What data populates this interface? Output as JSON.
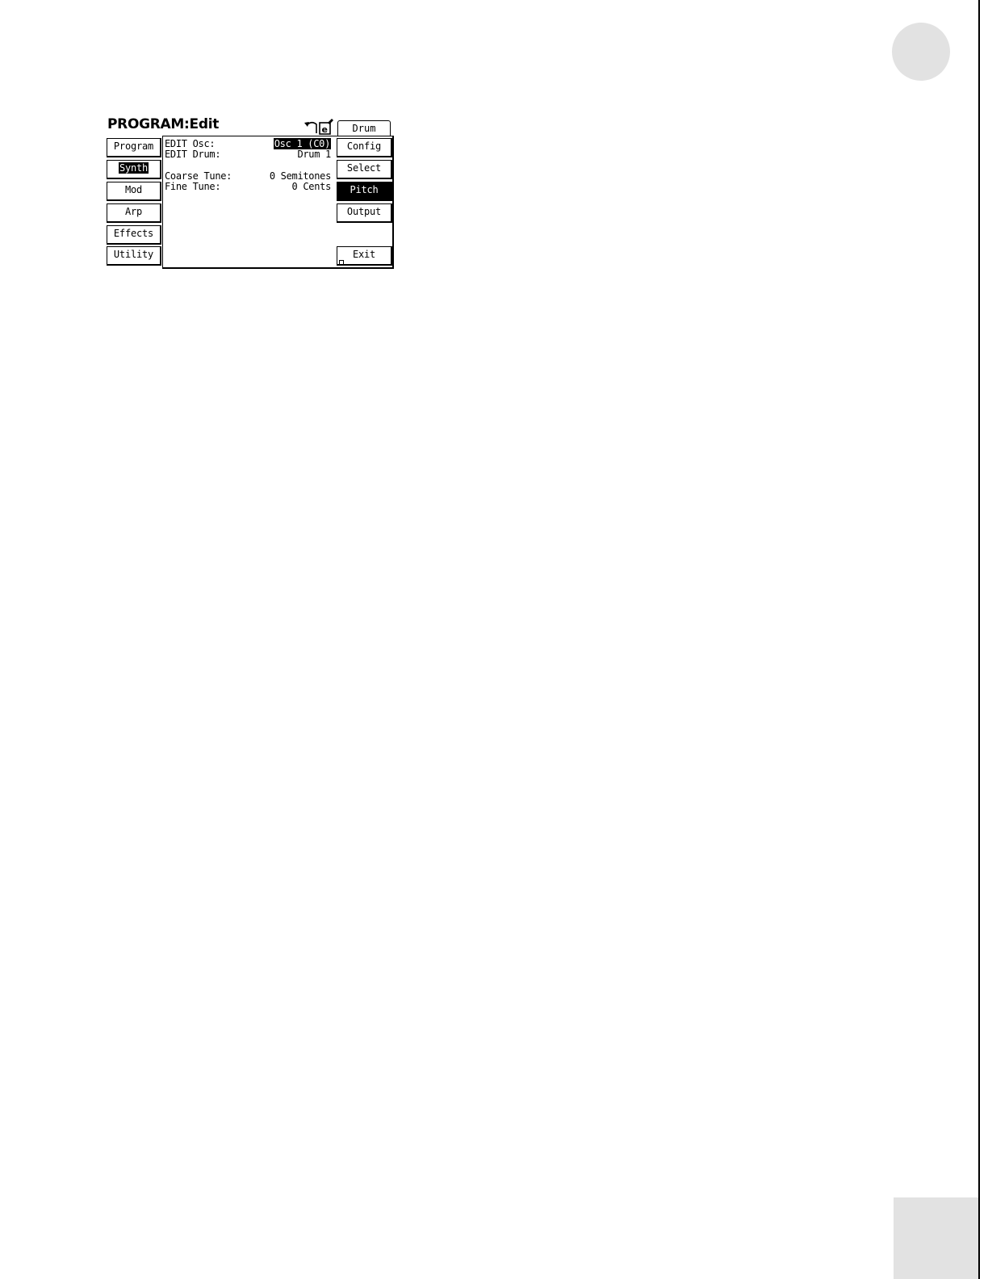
{
  "screen": {
    "title": "PROGRAM:Edit",
    "icons": [
      "undo-arrow-icon",
      "edit-document-icon"
    ]
  },
  "left_tabs": [
    {
      "label": "Program",
      "active": false,
      "selected": false
    },
    {
      "label": "Synth",
      "active": false,
      "selected": true
    },
    {
      "label": "Mod",
      "active": false,
      "selected": false
    },
    {
      "label": "Arp",
      "active": false,
      "selected": false
    },
    {
      "label": "Effects",
      "active": false,
      "selected": false
    },
    {
      "label": "Utility",
      "active": false,
      "selected": false
    }
  ],
  "top_right_tab": {
    "label": "Drum"
  },
  "right_buttons": [
    {
      "label": "Config",
      "active": false
    },
    {
      "label": "Select",
      "active": false
    },
    {
      "label": "Pitch",
      "active": true
    },
    {
      "label": "Output",
      "active": false
    },
    {
      "label": "Exit",
      "active": false
    }
  ],
  "parameters": [
    {
      "label": "EDIT Osc:",
      "value": "Osc 1 (C0)",
      "selected": true
    },
    {
      "label": "EDIT Drum:",
      "value": "Drum 1",
      "selected": false
    },
    {
      "label": "Coarse Tune:",
      "value": "0 Semitones",
      "selected": false
    },
    {
      "label": "Fine Tune:",
      "value": "0 Cents",
      "selected": false
    }
  ],
  "colors": {
    "lcd_ink": "#000000",
    "lcd_background": "#ffffff",
    "page_tab_gray": "#e2e2e2"
  }
}
